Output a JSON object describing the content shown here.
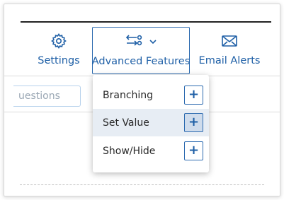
{
  "toolbar": {
    "settings": {
      "label": "Settings",
      "icon": "gear-icon"
    },
    "advanced": {
      "label": "Advanced Features",
      "icon": "branch-arrows-icon",
      "chevron": "chevron-down-icon"
    },
    "email": {
      "label": "Email Alerts",
      "icon": "envelope-icon"
    }
  },
  "questions_button": {
    "label": "uestions"
  },
  "dropdown": {
    "items": [
      {
        "label": "Branching",
        "action_icon": "plus-icon"
      },
      {
        "label": "Set Value",
        "action_icon": "plus-icon",
        "highlighted": true
      },
      {
        "label": "Show/Hide",
        "action_icon": "plus-icon"
      }
    ],
    "plus_glyph": "+"
  },
  "colors": {
    "accent": "#1e5fa6",
    "highlight": "#e7edf4",
    "border": "#2d6bb0"
  }
}
